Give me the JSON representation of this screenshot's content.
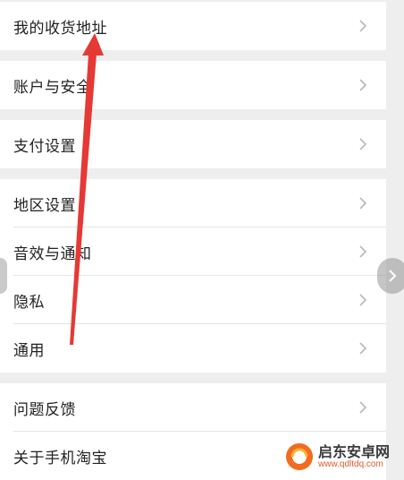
{
  "settings_list": {
    "items": [
      {
        "label": "我的收货地址"
      },
      {
        "label": "账户与安全"
      },
      {
        "label": "支付设置"
      },
      {
        "label": "地区设置"
      },
      {
        "label": "音效与通知"
      },
      {
        "label": "隐私"
      },
      {
        "label": "通用"
      },
      {
        "label": "问题反馈"
      },
      {
        "label": "关于手机淘宝"
      }
    ]
  },
  "watermark": {
    "title": "启东安卓网",
    "url": "www.qdltdq.com"
  },
  "colors": {
    "annotation_arrow": "#e53935",
    "background": "#eeeeee",
    "row_background": "#ffffff",
    "chevron": "#b8b8b8"
  },
  "icons": {
    "row_chevron": "chevron-right-icon",
    "side_nav": "chevron-right-icon"
  }
}
